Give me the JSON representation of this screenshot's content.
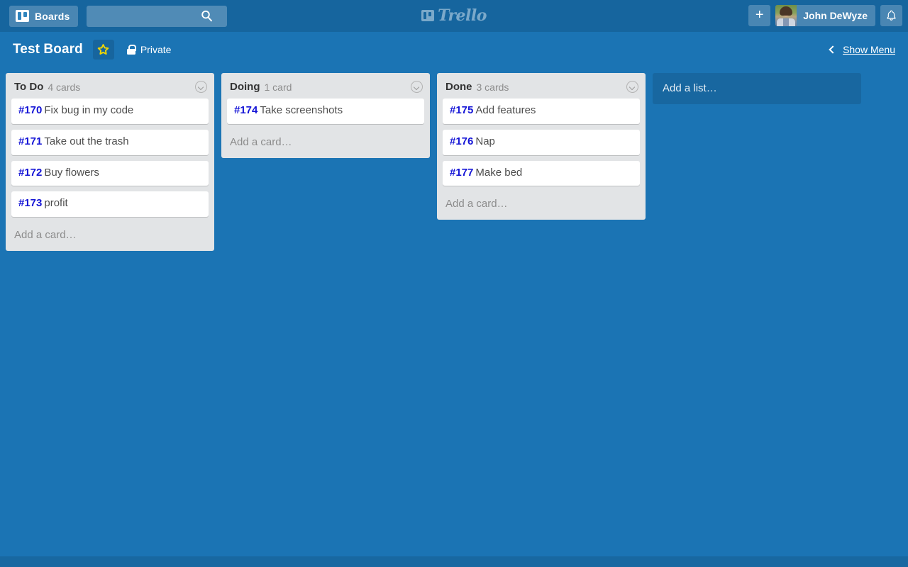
{
  "header": {
    "boards_button_label": "Boards",
    "boards_icon": "board-icon",
    "search_placeholder": "",
    "search_value": "",
    "search_icon": "search-icon",
    "logo_text": "Trello",
    "logo_icon": "board-icon",
    "add_button_label": "+",
    "member_name": "John DeWyze",
    "avatar": "user-avatar-photo",
    "notifications_icon": "bell-icon"
  },
  "board": {
    "title": "Test Board",
    "star_icon": "star-icon",
    "lock_icon": "lock-icon",
    "visibility": "Private",
    "show_menu_label": "Show Menu",
    "show_menu_icon": "chevron-left-icon"
  },
  "lists": [
    {
      "title": "To Do",
      "count": "4 cards",
      "menu_icon": "chevron-down-circle-icon",
      "add_card_label": "Add a card…",
      "cards": [
        {
          "number": "#170",
          "text": "Fix bug in my code"
        },
        {
          "number": "#171",
          "text": "Take out the trash"
        },
        {
          "number": "#172",
          "text": "Buy flowers"
        },
        {
          "number": "#173",
          "text": "profit"
        }
      ]
    },
    {
      "title": "Doing",
      "count": "1 card",
      "menu_icon": "chevron-down-circle-icon",
      "add_card_label": "Add a card…",
      "cards": [
        {
          "number": "#174",
          "text": "Take screenshots"
        }
      ]
    },
    {
      "title": "Done",
      "count": "3 cards",
      "menu_icon": "chevron-down-circle-icon",
      "add_card_label": "Add a card…",
      "cards": [
        {
          "number": "#175",
          "text": "Add features"
        },
        {
          "number": "#176",
          "text": "Nap"
        },
        {
          "number": "#177",
          "text": "Make bed"
        }
      ]
    }
  ],
  "add_list_label": "Add a list…",
  "colors": {
    "top_bar": "#16659e",
    "board_background": "#1b74b4",
    "list_background": "#e2e4e6",
    "card_background": "#ffffff",
    "card_number": "#1414d6",
    "star": "#f2d600"
  }
}
